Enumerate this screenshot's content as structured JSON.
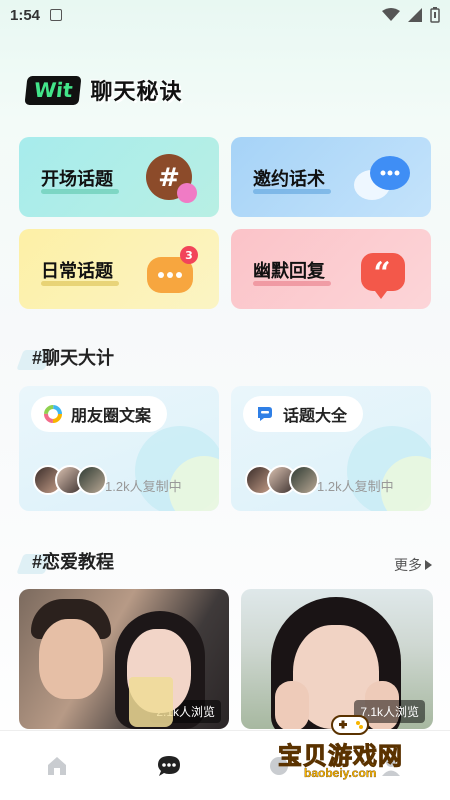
{
  "status_bar": {
    "time": "1:54"
  },
  "header": {
    "logo": "Wit",
    "title": "聊天秘诀"
  },
  "topics": [
    {
      "label": "开场话题"
    },
    {
      "label": "邀约话术"
    },
    {
      "label": "日常话题",
      "badge": "3"
    },
    {
      "label": "幽默回复"
    }
  ],
  "plan_section": {
    "title": "#聊天大计",
    "cards": [
      {
        "label": "朋友圈文案",
        "count": "1.2k人复制中"
      },
      {
        "label": "话题大全",
        "count": "1.2k人复制中"
      }
    ]
  },
  "tutorial_section": {
    "title": "#恋爱教程",
    "more": "更多",
    "items": [
      {
        "views": "2.1k人浏览"
      },
      {
        "views": "7.1k人浏览"
      }
    ]
  },
  "watermark": {
    "text": "宝贝游戏网",
    "url": "baobeiy.com"
  },
  "colors": {
    "accent": "#43e58a",
    "watermark": "#f7b500"
  }
}
